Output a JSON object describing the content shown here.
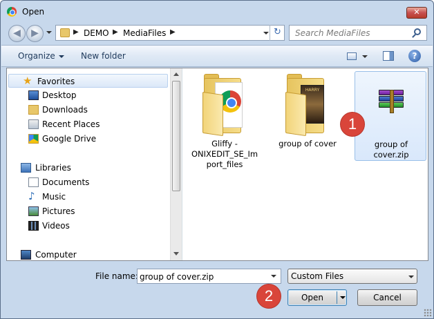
{
  "window": {
    "title": "Open",
    "close_glyph": "✕"
  },
  "nav": {
    "back_glyph": "◀",
    "forward_glyph": "▶"
  },
  "address": {
    "crumbs": [
      "DEMO",
      "MediaFiles"
    ],
    "separator": "▶",
    "refresh_glyph": "↻"
  },
  "search": {
    "placeholder": "Search MediaFiles"
  },
  "toolbar": {
    "organize_label": "Organize",
    "new_folder_label": "New folder",
    "help_glyph": "?"
  },
  "navpane": {
    "favorites": {
      "label": "Favorites",
      "items": [
        "Desktop",
        "Downloads",
        "Recent Places",
        "Google Drive"
      ]
    },
    "libraries": {
      "label": "Libraries",
      "items": [
        "Documents",
        "Music",
        "Pictures",
        "Videos"
      ]
    },
    "computer_label": "Computer"
  },
  "files": [
    {
      "name": "Gliffy - ONIXEDIT_SE_Import_files",
      "label_lines": [
        "Gliffy -",
        "ONIXEDIT_SE_Im",
        "port_files"
      ],
      "icon": "folder-chrome-icon",
      "selected": false
    },
    {
      "name": "group of cover",
      "label_lines": [
        "group of cover"
      ],
      "icon": "folder-book-icon",
      "selected": false,
      "thumb_text": "HARRY"
    },
    {
      "name": "group of cover.zip",
      "label_lines": [
        "group of",
        "cover.zip"
      ],
      "icon": "winrar-archive-icon",
      "selected": true
    }
  ],
  "bottom": {
    "filename_label": "File name:",
    "filename_value": "group of cover.zip",
    "filter_value": "Custom Files",
    "open_label": "Open",
    "cancel_label": "Cancel"
  },
  "annotations": {
    "badge_1": "1",
    "badge_2": "2",
    "badge_color": "#d9453a"
  }
}
